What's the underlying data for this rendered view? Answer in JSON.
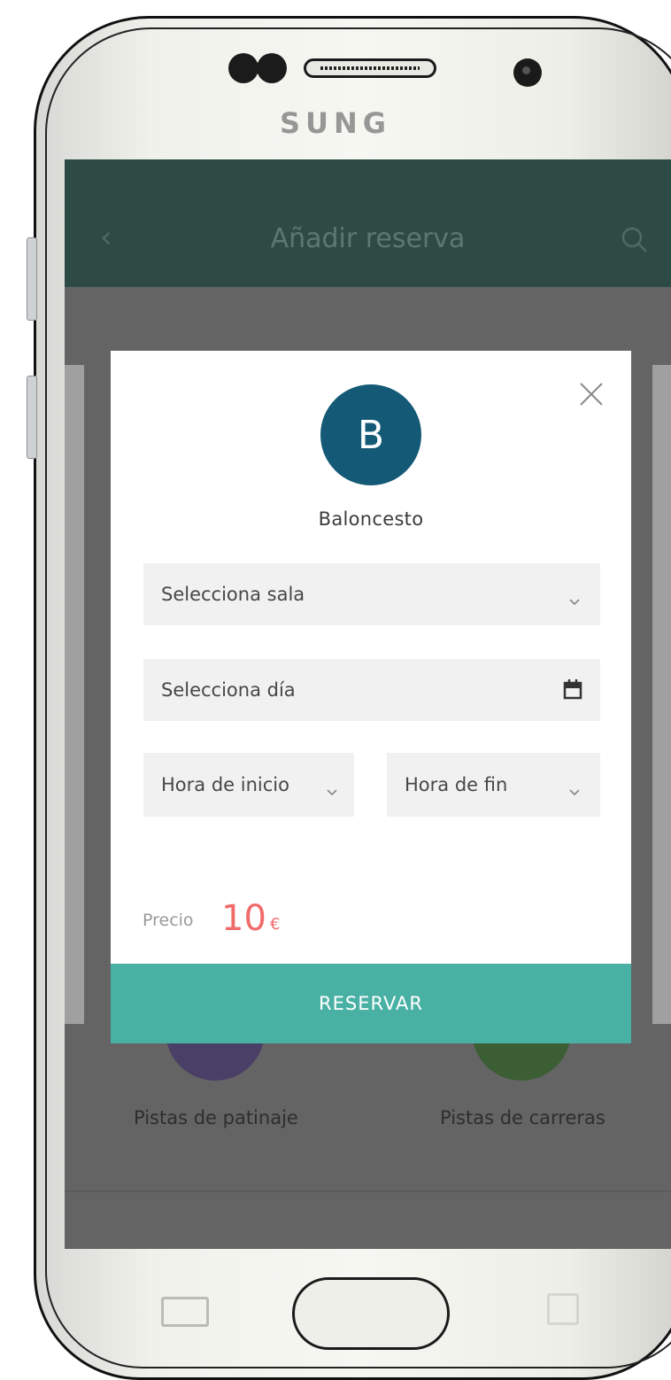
{
  "device": {
    "brand": "SUNG"
  },
  "app_bar": {
    "title": "Añadir reserva",
    "back_icon": "chevron-left-icon",
    "search_icon": "search-icon",
    "color": "#2e4a44"
  },
  "background": {
    "items": [
      {
        "label": "Pistas de patinaje",
        "color": "#4a3f66"
      },
      {
        "label": "Pistas de carreras",
        "color": "#3b5e34"
      }
    ]
  },
  "modal": {
    "close_icon": "close-icon",
    "avatar_letter": "B",
    "avatar_color": "#145a77",
    "sport_name": "Baloncesto",
    "room_select": {
      "placeholder": "Selecciona sala",
      "icon": "chevron-down-icon"
    },
    "day_select": {
      "placeholder": "Selecciona día",
      "icon": "calendar-icon"
    },
    "start_time": {
      "placeholder": "Hora de inicio",
      "icon": "chevron-down-icon"
    },
    "end_time": {
      "placeholder": "Hora de fin",
      "icon": "chevron-down-icon"
    },
    "price_label": "Precio",
    "price_value": "10",
    "price_currency": "€",
    "price_color": "#f26b6b",
    "reserve_label": "RESERVAR",
    "reserve_color": "#49b0a4"
  }
}
